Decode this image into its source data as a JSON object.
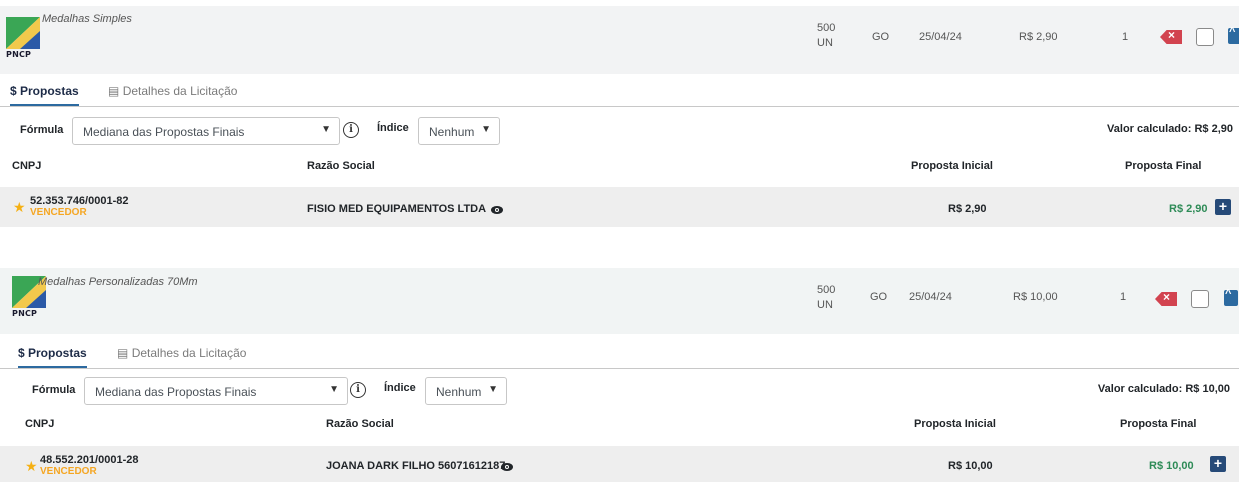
{
  "colors": {
    "accent": "#2c6aa0",
    "winner": "#f5a623",
    "final_price": "#2e8b57",
    "delete": "#d2434f"
  },
  "items": [
    {
      "logo_text": "PNCP",
      "title": "Medalhas Simples",
      "qty": "500",
      "unit": "UN",
      "uf": "GO",
      "date": "25/04/24",
      "price": "R$ 2,90",
      "count": "1",
      "tabs": {
        "proposals": "$ Propostas",
        "details": "Detalhes da Licitação"
      },
      "formula_label": "Fórmula",
      "formula_value": "Mediana das Propostas Finais",
      "index_label": "Índice",
      "index_value": "Nenhum",
      "calculated": "Valor calculado: R$ 2,90",
      "headers": {
        "cnpj": "CNPJ",
        "razao": "Razão Social",
        "inicial": "Proposta Inicial",
        "final": "Proposta Final"
      },
      "row": {
        "cnpj": "52.353.746/0001-82",
        "status": "VENCEDOR",
        "razao": "FISIO MED EQUIPAMENTOS LTDA",
        "inicial": "R$ 2,90",
        "final": "R$ 2,90"
      }
    },
    {
      "logo_text": "PNCP",
      "title": "Medalhas Personalizadas 70Mm",
      "qty": "500",
      "unit": "UN",
      "uf": "GO",
      "date": "25/04/24",
      "price": "R$ 10,00",
      "count": "1",
      "tabs": {
        "proposals": "$ Propostas",
        "details": "Detalhes da Licitação"
      },
      "formula_label": "Fórmula",
      "formula_value": "Mediana das Propostas Finais",
      "index_label": "Índice",
      "index_value": "Nenhum",
      "calculated": "Valor calculado: R$ 10,00",
      "headers": {
        "cnpj": "CNPJ",
        "razao": "Razão Social",
        "inicial": "Proposta Inicial",
        "final": "Proposta Final"
      },
      "row": {
        "cnpj": "48.552.201/0001-28",
        "status": "VENCEDOR",
        "razao": "JOANA DARK FILHO 56071612187",
        "inicial": "R$ 10,00",
        "final": "R$ 10,00"
      }
    }
  ]
}
